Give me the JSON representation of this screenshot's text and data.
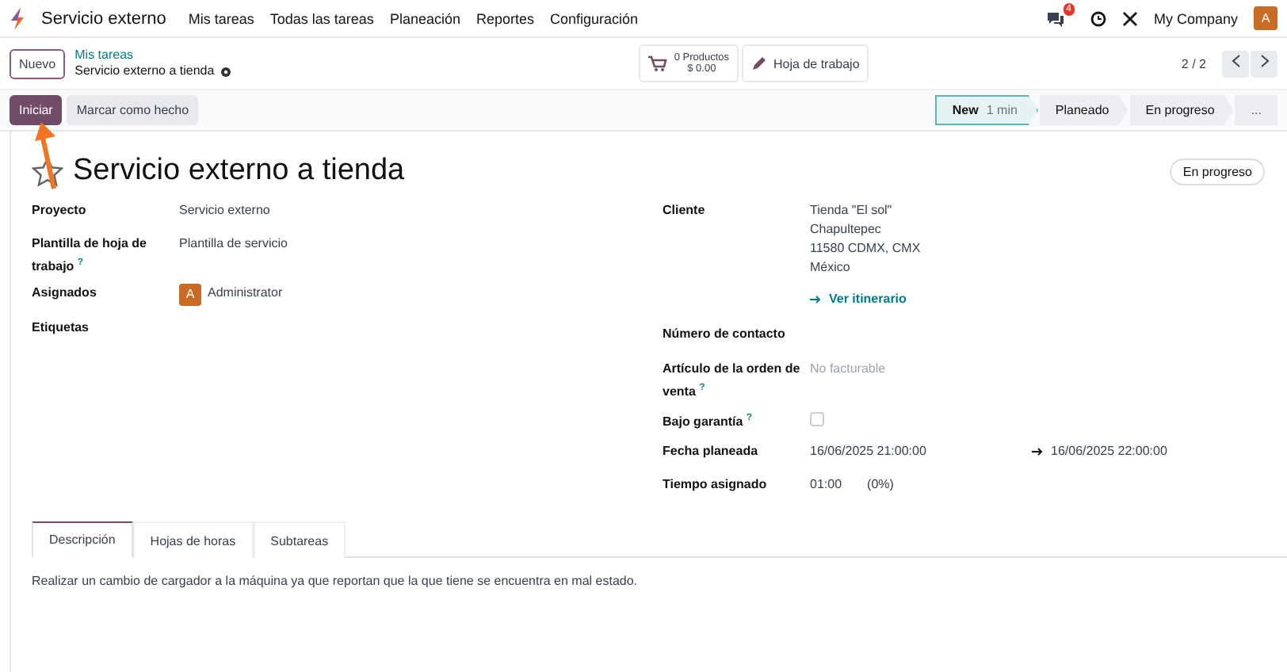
{
  "navbar": {
    "app_name": "Servicio externo",
    "menu": [
      "Mis tareas",
      "Todas las tareas",
      "Planeación",
      "Reportes",
      "Configuración"
    ],
    "notification_count": "4",
    "company": "My Company",
    "avatar": "A"
  },
  "control_panel": {
    "new_button": "Nuevo",
    "breadcrumb_parent": "Mis tareas",
    "breadcrumb_current": "Servicio externo a tienda",
    "products_count": "0 Productos",
    "products_amount": "$ 0.00",
    "worksheet_button": "Hoja de trabajo",
    "pager": "2 / 2"
  },
  "actions": [
    {
      "label": "Iniciar",
      "primary": true
    },
    {
      "label": "Marcar como hecho",
      "primary": false
    }
  ],
  "stages": [
    {
      "label": "New",
      "duration": "1 min",
      "selected": true
    },
    {
      "label": "Planeado",
      "selected": false
    },
    {
      "label": "En progreso",
      "selected": false
    }
  ],
  "stages_more": "...",
  "form": {
    "starred": false,
    "title": "Servicio externo a tienda",
    "status_badge": "En progreso",
    "left_fields": [
      {
        "kind": "text",
        "label": "Proyecto",
        "value": "Servicio externo"
      },
      {
        "kind": "text",
        "label": "Plantilla de hoja de trabajo",
        "help": "?",
        "value": "Plantilla de servicio"
      },
      {
        "kind": "avatar",
        "label": "Asignados",
        "initial": "A",
        "value": "Administrator"
      },
      {
        "kind": "empty",
        "label": "Etiquetas"
      }
    ],
    "right_fields": [
      {
        "kind": "address",
        "label": "Cliente",
        "lines": [
          "Tienda \"El sol\"",
          "Chapultepec",
          "11580 CDMX, CMX",
          "México"
        ],
        "link": "Ver itinerario"
      },
      {
        "kind": "empty",
        "label": "Número de contacto"
      },
      {
        "kind": "placeholder",
        "label": "Artículo de la orden de venta",
        "help": "?",
        "placeholder": "No facturable"
      },
      {
        "kind": "checkbox",
        "label": "Bajo garantía",
        "help": "?",
        "checked": false
      },
      {
        "kind": "daterange",
        "label": "Fecha planeada",
        "start": "16/06/2025 21:00:00",
        "end": "16/06/2025 22:00:00"
      },
      {
        "kind": "duration",
        "label": "Tiempo asignado",
        "value": "01:00",
        "percent": "(0%)"
      }
    ],
    "tabs": [
      {
        "label": "Descripción",
        "selected": true
      },
      {
        "label": "Hojas de horas",
        "selected": false
      },
      {
        "label": "Subtareas",
        "selected": false
      }
    ],
    "description": "Realizar un cambio de cargador a la máquina ya que reportan que la que tiene se encuentra en mal estado."
  }
}
